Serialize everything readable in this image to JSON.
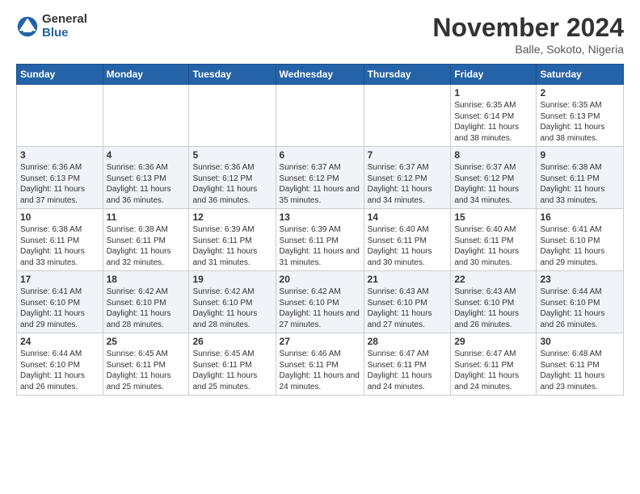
{
  "logo": {
    "general": "General",
    "blue": "Blue"
  },
  "header": {
    "month": "November 2024",
    "location": "Balle, Sokoto, Nigeria"
  },
  "days_of_week": [
    "Sunday",
    "Monday",
    "Tuesday",
    "Wednesday",
    "Thursday",
    "Friday",
    "Saturday"
  ],
  "weeks": [
    [
      {
        "day": "",
        "info": ""
      },
      {
        "day": "",
        "info": ""
      },
      {
        "day": "",
        "info": ""
      },
      {
        "day": "",
        "info": ""
      },
      {
        "day": "",
        "info": ""
      },
      {
        "day": "1",
        "info": "Sunrise: 6:35 AM\nSunset: 6:14 PM\nDaylight: 11 hours and 38 minutes."
      },
      {
        "day": "2",
        "info": "Sunrise: 6:35 AM\nSunset: 6:13 PM\nDaylight: 11 hours and 38 minutes."
      }
    ],
    [
      {
        "day": "3",
        "info": "Sunrise: 6:36 AM\nSunset: 6:13 PM\nDaylight: 11 hours and 37 minutes."
      },
      {
        "day": "4",
        "info": "Sunrise: 6:36 AM\nSunset: 6:13 PM\nDaylight: 11 hours and 36 minutes."
      },
      {
        "day": "5",
        "info": "Sunrise: 6:36 AM\nSunset: 6:12 PM\nDaylight: 11 hours and 36 minutes."
      },
      {
        "day": "6",
        "info": "Sunrise: 6:37 AM\nSunset: 6:12 PM\nDaylight: 11 hours and 35 minutes."
      },
      {
        "day": "7",
        "info": "Sunrise: 6:37 AM\nSunset: 6:12 PM\nDaylight: 11 hours and 34 minutes."
      },
      {
        "day": "8",
        "info": "Sunrise: 6:37 AM\nSunset: 6:12 PM\nDaylight: 11 hours and 34 minutes."
      },
      {
        "day": "9",
        "info": "Sunrise: 6:38 AM\nSunset: 6:11 PM\nDaylight: 11 hours and 33 minutes."
      }
    ],
    [
      {
        "day": "10",
        "info": "Sunrise: 6:38 AM\nSunset: 6:11 PM\nDaylight: 11 hours and 33 minutes."
      },
      {
        "day": "11",
        "info": "Sunrise: 6:38 AM\nSunset: 6:11 PM\nDaylight: 11 hours and 32 minutes."
      },
      {
        "day": "12",
        "info": "Sunrise: 6:39 AM\nSunset: 6:11 PM\nDaylight: 11 hours and 31 minutes."
      },
      {
        "day": "13",
        "info": "Sunrise: 6:39 AM\nSunset: 6:11 PM\nDaylight: 11 hours and 31 minutes."
      },
      {
        "day": "14",
        "info": "Sunrise: 6:40 AM\nSunset: 6:11 PM\nDaylight: 11 hours and 30 minutes."
      },
      {
        "day": "15",
        "info": "Sunrise: 6:40 AM\nSunset: 6:11 PM\nDaylight: 11 hours and 30 minutes."
      },
      {
        "day": "16",
        "info": "Sunrise: 6:41 AM\nSunset: 6:10 PM\nDaylight: 11 hours and 29 minutes."
      }
    ],
    [
      {
        "day": "17",
        "info": "Sunrise: 6:41 AM\nSunset: 6:10 PM\nDaylight: 11 hours and 29 minutes."
      },
      {
        "day": "18",
        "info": "Sunrise: 6:42 AM\nSunset: 6:10 PM\nDaylight: 11 hours and 28 minutes."
      },
      {
        "day": "19",
        "info": "Sunrise: 6:42 AM\nSunset: 6:10 PM\nDaylight: 11 hours and 28 minutes."
      },
      {
        "day": "20",
        "info": "Sunrise: 6:42 AM\nSunset: 6:10 PM\nDaylight: 11 hours and 27 minutes."
      },
      {
        "day": "21",
        "info": "Sunrise: 6:43 AM\nSunset: 6:10 PM\nDaylight: 11 hours and 27 minutes."
      },
      {
        "day": "22",
        "info": "Sunrise: 6:43 AM\nSunset: 6:10 PM\nDaylight: 11 hours and 26 minutes."
      },
      {
        "day": "23",
        "info": "Sunrise: 6:44 AM\nSunset: 6:10 PM\nDaylight: 11 hours and 26 minutes."
      }
    ],
    [
      {
        "day": "24",
        "info": "Sunrise: 6:44 AM\nSunset: 6:10 PM\nDaylight: 11 hours and 26 minutes."
      },
      {
        "day": "25",
        "info": "Sunrise: 6:45 AM\nSunset: 6:11 PM\nDaylight: 11 hours and 25 minutes."
      },
      {
        "day": "26",
        "info": "Sunrise: 6:45 AM\nSunset: 6:11 PM\nDaylight: 11 hours and 25 minutes."
      },
      {
        "day": "27",
        "info": "Sunrise: 6:46 AM\nSunset: 6:11 PM\nDaylight: 11 hours and 24 minutes."
      },
      {
        "day": "28",
        "info": "Sunrise: 6:47 AM\nSunset: 6:11 PM\nDaylight: 11 hours and 24 minutes."
      },
      {
        "day": "29",
        "info": "Sunrise: 6:47 AM\nSunset: 6:11 PM\nDaylight: 11 hours and 24 minutes."
      },
      {
        "day": "30",
        "info": "Sunrise: 6:48 AM\nSunset: 6:11 PM\nDaylight: 11 hours and 23 minutes."
      }
    ]
  ]
}
